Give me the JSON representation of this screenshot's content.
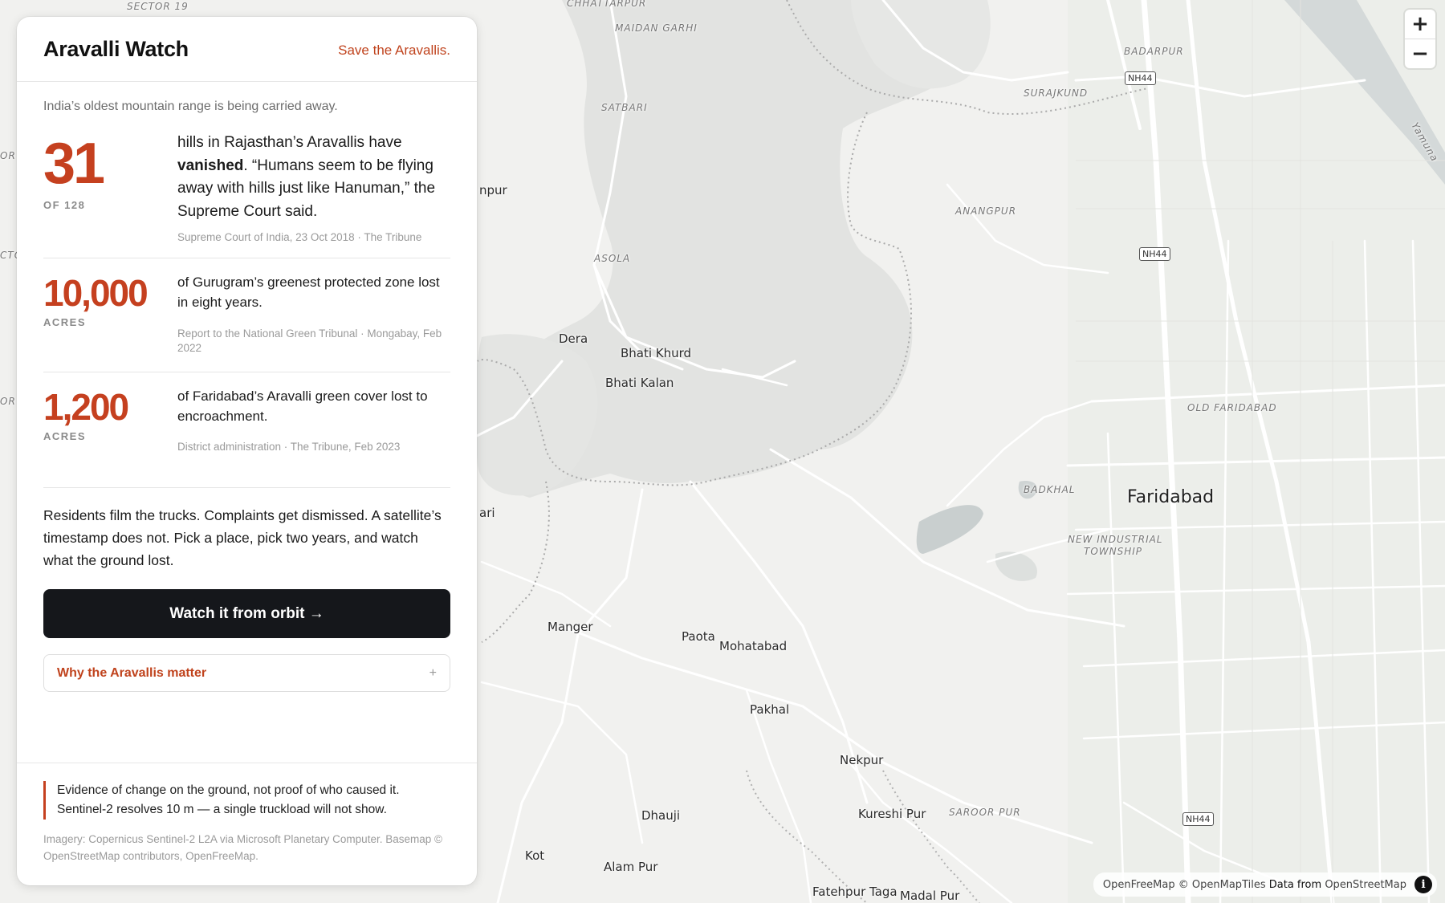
{
  "panel": {
    "title": "Aravalli Watch",
    "tagline_link": "Save the Aravallis.",
    "intro": "India’s oldest mountain range is being carried away.",
    "stats": [
      {
        "number": "31",
        "unit": "OF 128",
        "desc_pre": "hills in Rajasthan’s Aravallis have ",
        "desc_bold": "vanished",
        "desc_post": ". “Humans seem to be flying away with hills just like Hanuman,” the Supreme Court said.",
        "source": "Supreme Court of India, 23 Oct 2018 · The Tribune"
      },
      {
        "number": "10,000",
        "unit": "ACRES",
        "desc": "of Gurugram’s greenest protected zone lost in eight years.",
        "source": "Report to the National Green Tribunal · Mongabay, Feb 2022"
      },
      {
        "number": "1,200",
        "unit": "ACRES",
        "desc": "of Faridabad’s Aravalli green cover lost to encroachment.",
        "source": "District administration · The Tribune, Feb 2023"
      }
    ],
    "pitch": "Residents film the trucks. Complaints get dismissed. A satellite’s timestamp does not. Pick a place, pick two years, and watch what the ground lost.",
    "cta_label": "Watch it from orbit →",
    "accordion_label": "Why the Aravallis matter",
    "accordion_icon": "+",
    "disclaimer_line1": "Evidence of change on the ground, not proof of who caused it.",
    "disclaimer_line2": "Sentinel-2 resolves 10 m — a single truckload will not show.",
    "credits": "Imagery: Copernicus Sentinel-2 L2A via Microsoft Planetary Computer. Basemap © OpenStreetMap contributors, OpenFreeMap."
  },
  "map": {
    "labels": {
      "sector19": "SECTOR 19",
      "chhattarpur": "CHHATTARPUR",
      "maidan_garhi": "MAIDAN GARHI",
      "satbari": "SATBARI",
      "badarpur": "BADARPUR",
      "surajkund": "SURAJKUND",
      "anangpur": "ANANGPUR",
      "asola": "ASOLA",
      "dera": "Dera",
      "bhati_khurd": "Bhati Khurd",
      "bhati_kalan": "Bhati Kalan",
      "old_faridabad": "OLD FARIDABAD",
      "badkhal": "BADKHAL",
      "faridabad": "Faridabad",
      "nit_line1": "NEW INDUSTRIAL",
      "nit_line2": "TOWNSHIP",
      "manger": "Manger",
      "paota": "Paota",
      "mohatabad": "Mohatabad",
      "pakhal": "Pakhal",
      "nekpur": "Nekpur",
      "dhauji": "Dhauji",
      "kureshi_pur": "Kureshi Pur",
      "saroor_pur": "SAROOR PUR",
      "kot": "Kot",
      "alam_pur": "Alam Pur",
      "fatehpur_taga": "Fatehpur Taga",
      "madal_pur": "Madal Pur",
      "yamuna": "Yamuna",
      "edge_pur": "npur",
      "edge_ari": "ari",
      "edge_or1": "OR",
      "edge_cto": "CTO",
      "edge_or2": "OR"
    },
    "shields": [
      "NH44",
      "NH44",
      "NH44"
    ],
    "zoom_in": "+",
    "zoom_out": "−",
    "attribution": {
      "openfreemap": "OpenFreeMap",
      "copy": "©",
      "openmaptiles": "OpenMapTiles",
      "data_from": "Data from",
      "osm": "OpenStreetMap",
      "info_icon": "i"
    }
  },
  "colors": {
    "accent": "#c5401f",
    "cta_bg": "#15171b",
    "map_bg": "#f1f1ef",
    "forest": "#e3e4e2",
    "water": "#c9cfcf"
  }
}
